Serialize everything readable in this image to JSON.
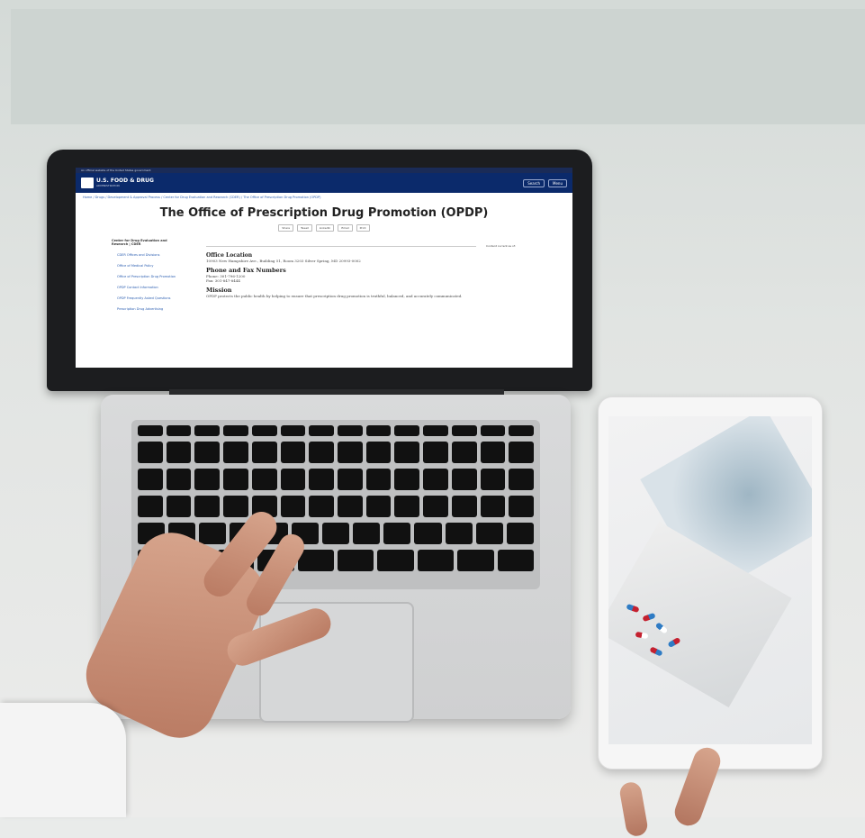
{
  "browser_page": {
    "gov_banner": "An official website of the United States government",
    "logo_title": "U.S. FOOD & DRUG",
    "logo_subtitle": "ADMINISTRATION",
    "search_label": "Search",
    "menu_label": "Menu",
    "breadcrumbs": "Home / Drugs / Development & Approval Process / Center for Drug Evaluation and Research (CDER) / The Office of Prescription Drug Promotion (OPDP)",
    "title": "The Office of Prescription Drug Promotion (OPDP)",
    "share": [
      "Share",
      "Tweet",
      "LinkedIn",
      "Email",
      "Print"
    ],
    "left_nav": {
      "heading": "Center for Drug Evaluation and Research | CDER",
      "items": [
        "CDER Offices and Divisions",
        "Office of Medical Policy",
        "Office of Prescription Drug Promotion",
        "OPDP Contact Information",
        "OPDP Frequently Asked Questions",
        "Prescription Drug Advertising"
      ]
    },
    "content_current": "Content current as of:",
    "sections": {
      "office_location_heading": "Office Location",
      "office_location_text": "10903 New Hampshire Ave., Building 51, Room 3203 Silver Spring, MD 20993-0002",
      "phone_heading": "Phone and Fax Numbers",
      "phone_text": "Phone: 301-796-1200",
      "fax_text": "Fax: 301-847-8444",
      "mission_heading": "Mission",
      "mission_text": "OPDP protects the public health by helping to ensure that prescription drug promotion is truthful, balanced, and accurately communicated."
    }
  },
  "colors": {
    "fda_blue": "#0b2a6b",
    "link_blue": "#2a5db0"
  }
}
